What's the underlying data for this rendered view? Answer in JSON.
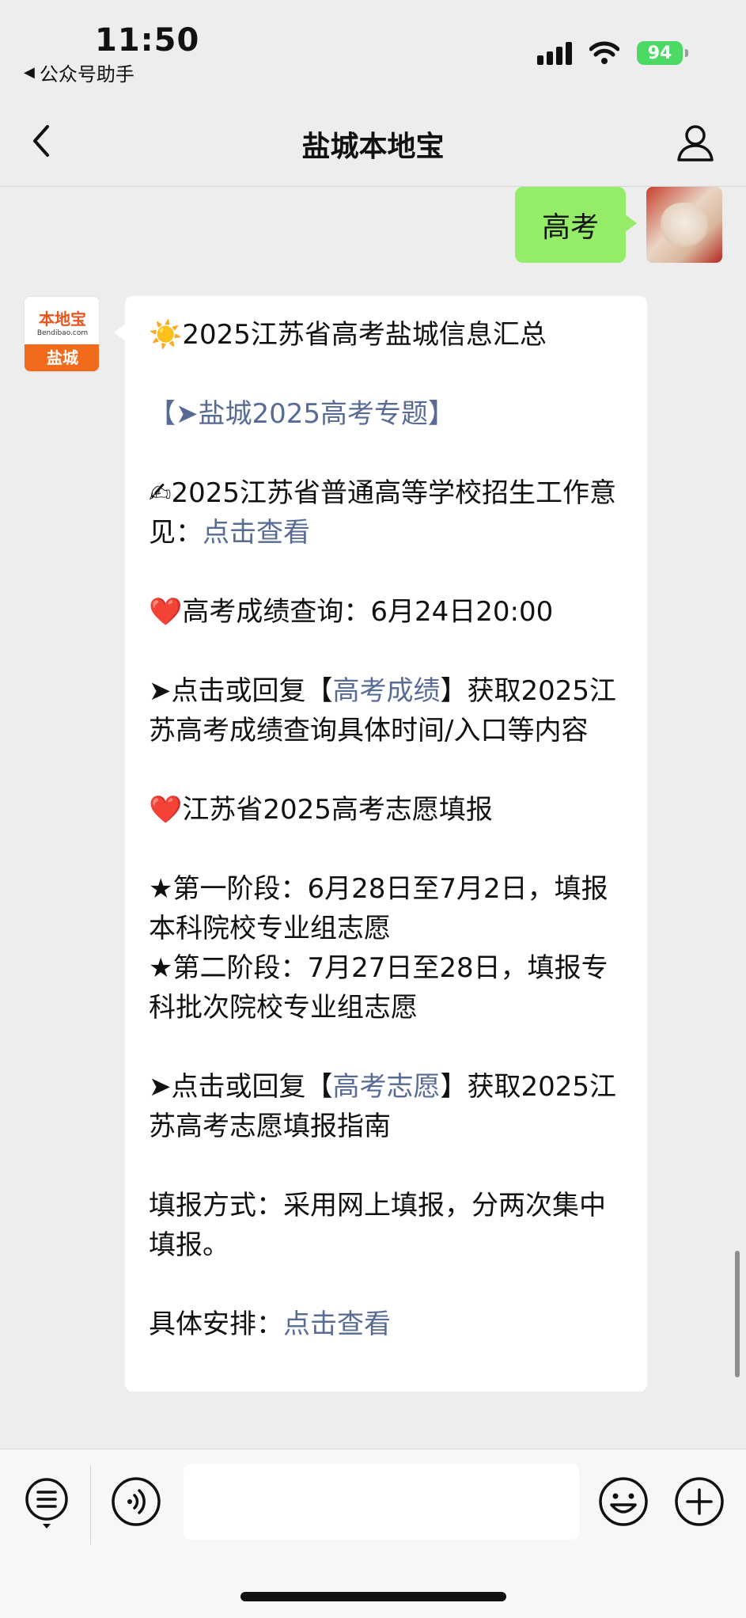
{
  "status_bar": {
    "time": "11:50",
    "back_app": "公众号助手",
    "battery": "94"
  },
  "nav": {
    "title": "盐城本地宝"
  },
  "user_message": {
    "text": "高考"
  },
  "bot_avatar": {
    "logo": "本地宝",
    "site": "Bendibao.com",
    "city": "盐城"
  },
  "bot_message": {
    "p1_emoji": "☀️",
    "p1_text": "2025江苏省高考盐城信息汇总",
    "p2_link": "【➤盐城2025高考专题】",
    "p3_emoji": "✍",
    "p3_text": "2025江苏省普通高等学校招生工作意见：",
    "p3_link": "点击查看",
    "p4_emoji": "❤️",
    "p4_text": "高考成绩查询：6月24日20:00",
    "p5_prefix": "➤点击或回复【",
    "p5_link": "高考成绩",
    "p5_suffix": "】获取2025江苏高考成绩查询具体时间/入口等内容",
    "p6_emoji": "❤️",
    "p6_text": "江苏省2025高考志愿填报",
    "p7_line1": "★第一阶段：6月28日至7月2日，填报本科院校专业组志愿",
    "p7_line2": "★第二阶段：7月27日至28日，填报专科批次院校专业组志愿",
    "p8_prefix": "➤点击或回复【",
    "p8_link": "高考志愿",
    "p8_suffix": "】获取2025江苏高考志愿填报指南",
    "p9_text": "填报方式：采用网上填报，分两次集中填报。",
    "p10_text": "具体安排：",
    "p10_link": "点击查看"
  },
  "input_bar": {
    "icons": [
      "menu-icon",
      "voice-icon",
      "emoji-icon",
      "plus-icon"
    ],
    "input_value": ""
  },
  "colors": {
    "link": "#576b95",
    "bubble_green": "#95ec69",
    "battery": "#4cd964",
    "brand_orange": "#f26a1b"
  }
}
